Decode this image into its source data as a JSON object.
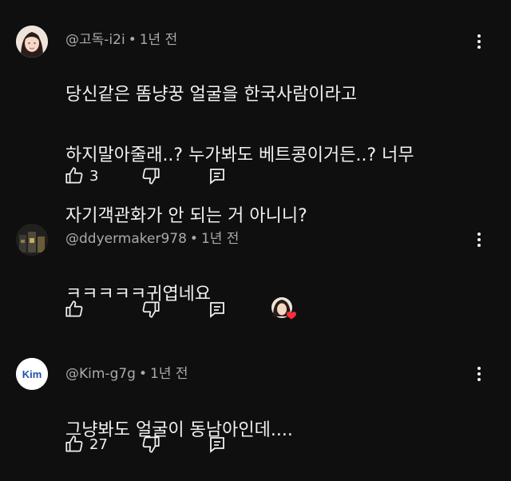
{
  "comments": [
    {
      "author": "@고독-i2i",
      "time": "1년 전",
      "text_lines": [
        "당신같은 똠냥꿍 얼굴을 한국사람이라고",
        "하지말아줄래..? 누가봐도 베트콩이거든..? 너무",
        "자기객관화가 안 되는 거 아니니?"
      ],
      "likes": "3",
      "avatar_icon": "person-photo-avatar"
    },
    {
      "author": "@ddyermaker978",
      "time": "1년 전",
      "text_lines": [
        "ㅋㅋㅋㅋㅋ귀엽네요"
      ],
      "likes": "",
      "avatar_icon": "bottles-photo-avatar",
      "creator_heart": true
    },
    {
      "author": "@Kim-g7g",
      "time": "1년 전",
      "text_lines": [
        "그냥봐도 얼굴이 동남아인데...."
      ],
      "likes": "27",
      "avatar_icon": "kim-logo-avatar",
      "avatar_text": "Kim"
    }
  ],
  "separator": "•",
  "icons": {
    "like": "thumbs-up-icon",
    "dislike": "thumbs-down-icon",
    "reply": "reply-icon",
    "more": "more-vertical-icon",
    "heart": "heart-icon"
  },
  "colors": {
    "background": "#0f0f0f",
    "text": "#f1f1f1",
    "meta": "#aaaaaa",
    "heart": "#ff2b3a"
  }
}
